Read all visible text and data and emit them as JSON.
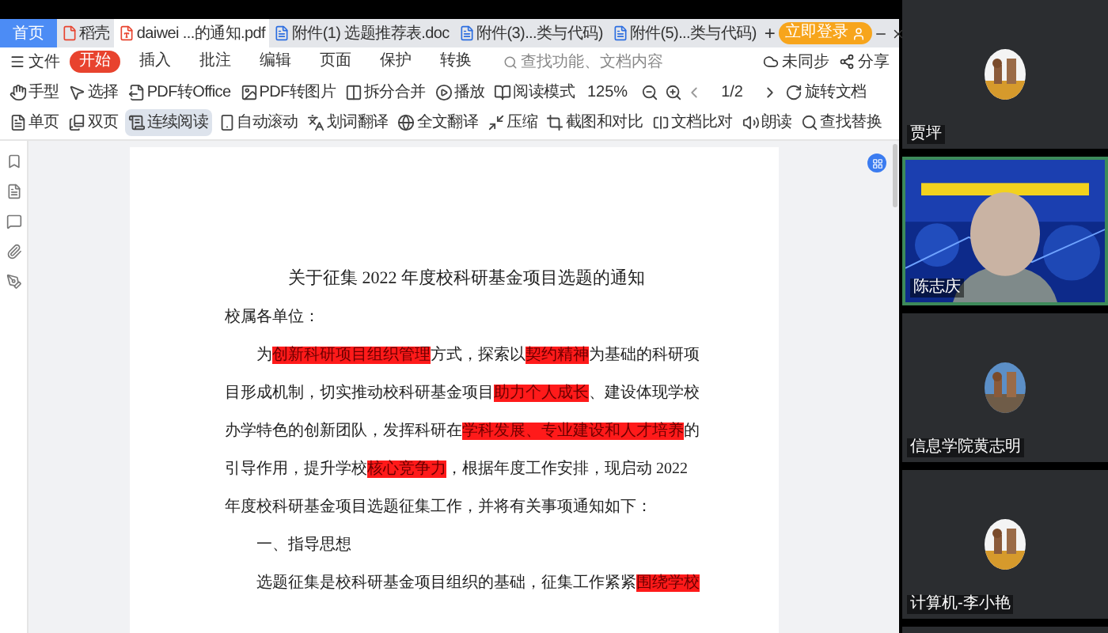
{
  "tabs": [
    {
      "label": "首页",
      "kind": "home",
      "selected": false
    },
    {
      "label": "稻壳",
      "kind": "docer",
      "selected": false
    },
    {
      "label": "daiwei ...的通知.pdf",
      "kind": "pdf",
      "selected": true
    },
    {
      "label": "附件(1) 选题推荐表.doc",
      "kind": "doc",
      "selected": false
    },
    {
      "label": "附件(3)...类与代码)",
      "kind": "doc",
      "selected": false
    },
    {
      "label": "附件(5)...类与代码)",
      "kind": "doc",
      "selected": false
    }
  ],
  "new_tab": "+",
  "login_button": "立即登录",
  "file_menu": "文件",
  "menu": [
    {
      "label": "开始",
      "selected": true
    },
    {
      "label": "插入",
      "selected": false
    },
    {
      "label": "批注",
      "selected": false
    },
    {
      "label": "编辑",
      "selected": false
    },
    {
      "label": "页面",
      "selected": false
    },
    {
      "label": "保护",
      "selected": false
    },
    {
      "label": "转换",
      "selected": false
    }
  ],
  "search": {
    "placeholder": "查找功能、文档内容"
  },
  "sync": "未同步",
  "share": "分享",
  "toolbar": [
    {
      "kind": "tool",
      "label": "手型"
    },
    {
      "kind": "tool",
      "label": "选择"
    },
    {
      "kind": "tool",
      "label": "PDF转Office"
    },
    {
      "kind": "tool",
      "label": "PDF转图片"
    },
    {
      "kind": "tool",
      "label": "拆分合并"
    },
    {
      "kind": "tool",
      "label": "播放"
    },
    {
      "kind": "tool",
      "label": "阅读模式"
    },
    {
      "kind": "zoom",
      "label": "125%"
    },
    {
      "kind": "page",
      "label": "1/2"
    },
    {
      "kind": "tool",
      "label": "旋转文档"
    },
    {
      "kind": "view",
      "label": "单页",
      "selected": false
    },
    {
      "kind": "view",
      "label": "双页",
      "selected": false
    },
    {
      "kind": "view",
      "label": "连续阅读",
      "selected": true
    },
    {
      "kind": "tool",
      "label": "自动滚动"
    },
    {
      "kind": "tool",
      "label": "划词翻译"
    },
    {
      "kind": "tool",
      "label": "全文翻译"
    },
    {
      "kind": "tool",
      "label": "压缩"
    },
    {
      "kind": "tool",
      "label": "截图和对比"
    },
    {
      "kind": "tool",
      "label": "文档比对"
    },
    {
      "kind": "tool",
      "label": "朗读"
    },
    {
      "kind": "tool",
      "label": "查找替换"
    }
  ],
  "document": {
    "title": "关于征集 2022 年度校科研基金项目选题的通知",
    "lines": [
      {
        "indent": false,
        "segments": [
          {
            "text": "校属各单位：",
            "highlight": false
          }
        ]
      },
      {
        "indent": true,
        "segments": [
          {
            "text": "为",
            "highlight": false
          },
          {
            "text": "创新科研项目组织管理",
            "highlight": true
          },
          {
            "text": "方式，探索以",
            "highlight": false
          },
          {
            "text": "契约精神",
            "highlight": true
          },
          {
            "text": "为基础的科研项",
            "highlight": false
          }
        ]
      },
      {
        "indent": false,
        "segments": [
          {
            "text": "目形成机制，切实推动校科研基金项目",
            "highlight": false
          },
          {
            "text": "助力个人成长",
            "highlight": true
          },
          {
            "text": "、建设体现学校",
            "highlight": false
          }
        ]
      },
      {
        "indent": false,
        "segments": [
          {
            "text": "办学特色的创新团队，发挥科研在",
            "highlight": false
          },
          {
            "text": "学科发展、专业建设和人才培养",
            "highlight": true
          },
          {
            "text": "的",
            "highlight": false
          }
        ]
      },
      {
        "indent": false,
        "segments": [
          {
            "text": "引导作用，提升学校",
            "highlight": false
          },
          {
            "text": "核心竞争力",
            "highlight": true
          },
          {
            "text": "，根据年度工作安排，现启动 2022",
            "highlight": false
          }
        ]
      },
      {
        "indent": false,
        "segments": [
          {
            "text": "年度校科研基金项目选题征集工作，并将有关事项通知如下：",
            "highlight": false
          }
        ]
      },
      {
        "indent": true,
        "segments": [
          {
            "text": "一、指导思想",
            "highlight": false
          }
        ]
      },
      {
        "indent": true,
        "segments": [
          {
            "text": "选题征集是校科研基金项目组织的基础，征集工作紧紧",
            "highlight": false
          },
          {
            "text": "围绕学校",
            "highlight": true
          }
        ]
      }
    ]
  },
  "participants": [
    {
      "name": "贾坪",
      "kind": "avatar"
    },
    {
      "name": "陈志庆",
      "kind": "video"
    },
    {
      "name": "信息学院黄志明",
      "kind": "avatar"
    },
    {
      "name": "计算机-李小艳",
      "kind": "avatar"
    },
    {
      "kind": "empty"
    }
  ]
}
